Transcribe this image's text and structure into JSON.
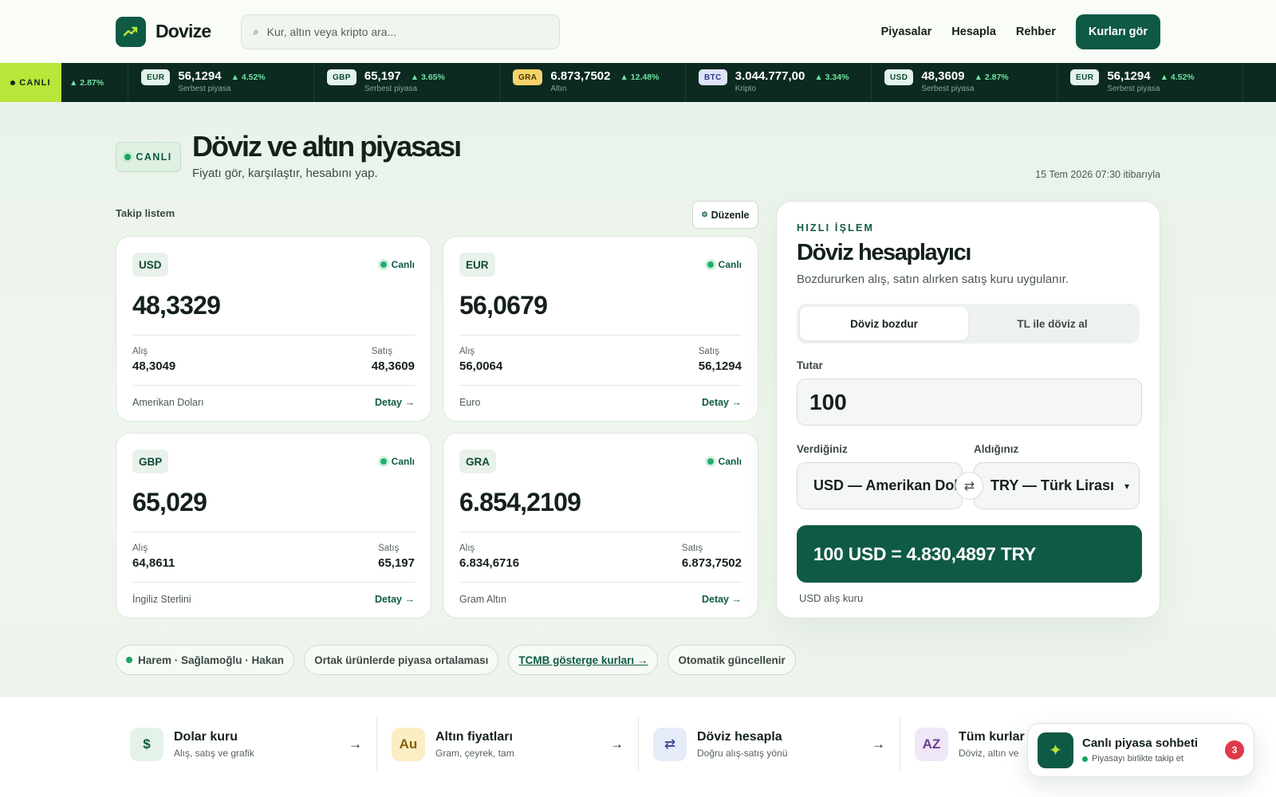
{
  "brand": {
    "name": "Dovize"
  },
  "search": {
    "placeholder": "Kur, altın veya kripto ara..."
  },
  "nav": {
    "items": [
      "Piyasalar",
      "Hesapla",
      "Rehber"
    ],
    "cta": "Kurları gör"
  },
  "ticker": {
    "live_label": "CANLI",
    "lead_change": "▲ 2.87%",
    "items": [
      {
        "code": "EUR",
        "value": "56,1294",
        "change": "▲ 4.52%",
        "sub": "Serbest piyasa"
      },
      {
        "code": "GBP",
        "value": "65,197",
        "change": "▲ 3.65%",
        "sub": "Serbest piyasa"
      },
      {
        "code": "GRA",
        "value": "6.873,7502",
        "change": "▲ 12.48%",
        "sub": "Altın"
      },
      {
        "code": "BTC",
        "value": "3.044.777,00",
        "change": "▲ 3.34%",
        "sub": "Kripto"
      },
      {
        "code": "USD",
        "value": "48,3609",
        "change": "▲ 2.87%",
        "sub": "Serbest piyasa"
      },
      {
        "code": "EUR",
        "value": "56,1294",
        "change": "▲ 4.52%",
        "sub": "Serbest piyasa"
      }
    ]
  },
  "hero": {
    "badge": "CANLI",
    "title": "Döviz ve altın piyasası",
    "subtitle": "Fiyatı gör, karşılaştır, hesabını yap.",
    "as_of": "15 Tem 2026 07:30 itibarıyla"
  },
  "watchlist": {
    "label": "Takip listem",
    "edit_label": "Düzenle",
    "cards": [
      {
        "code": "USD",
        "live": "Canlı",
        "value": "48,3329",
        "buy_label": "Alış",
        "buy": "48,3049",
        "sell_label": "Satış",
        "sell": "48,3609",
        "name": "Amerikan Doları",
        "detail": "Detay →"
      },
      {
        "code": "EUR",
        "live": "Canlı",
        "value": "56,0679",
        "buy_label": "Alış",
        "buy": "56,0064",
        "sell_label": "Satış",
        "sell": "56,1294",
        "name": "Euro",
        "detail": "Detay →"
      },
      {
        "code": "GBP",
        "live": "Canlı",
        "value": "65,029",
        "buy_label": "Alış",
        "buy": "64,8611",
        "sell_label": "Satış",
        "sell": "65,197",
        "name": "İngiliz Sterlini",
        "detail": "Detay →"
      },
      {
        "code": "GRA",
        "live": "Canlı",
        "value": "6.854,2109",
        "buy_label": "Alış",
        "buy": "6.834,6716",
        "sell_label": "Satış",
        "sell": "6.873,7502",
        "name": "Gram Altın",
        "detail": "Detay →"
      }
    ]
  },
  "chips": [
    "Harem · Sağlamoğlu · Hakan",
    "Ortak ürünlerde piyasa ortalaması",
    "TCMB gösterge kurları →",
    "Otomatik güncellenir"
  ],
  "calculator": {
    "eyebrow": "HIZLI İŞLEM",
    "title": "Döviz hesaplayıcı",
    "description": "Bozdururken alış, satın alırken satış kuru uygulanır.",
    "tabs": [
      "Döviz bozdur",
      "TL ile döviz al"
    ],
    "amount_label": "Tutar",
    "amount": "100",
    "from_label": "Verdiğiniz",
    "from_value": "USD — Amerikan Doları",
    "to_label": "Aldığınız",
    "to_value": "TRY — Türk Lirası",
    "result": "100 USD = 4.830,4897 TRY",
    "note": "USD alış kuru"
  },
  "strip": [
    {
      "icon": "$",
      "title": "Dolar kuru",
      "sub": "Alış, satış ve grafik"
    },
    {
      "icon": "Au",
      "title": "Altın fiyatları",
      "sub": "Gram, çeyrek, tam"
    },
    {
      "icon": "⇄",
      "title": "Döviz hesapla",
      "sub": "Doğru alış-satış yönü"
    },
    {
      "icon": "AZ",
      "title": "Tüm kurlar",
      "sub": "Döviz, altın ve"
    }
  ],
  "chat": {
    "title": "Canlı piyasa sohbeti",
    "subtitle": "Piyasayı birlikte takip et",
    "badge": "3"
  },
  "colors": {
    "primary": "#0f5a45",
    "accent": "#b8e639",
    "ticker_bg": "#0c2a20",
    "positive": "#6fe3a2",
    "alert": "#e03a4a"
  }
}
